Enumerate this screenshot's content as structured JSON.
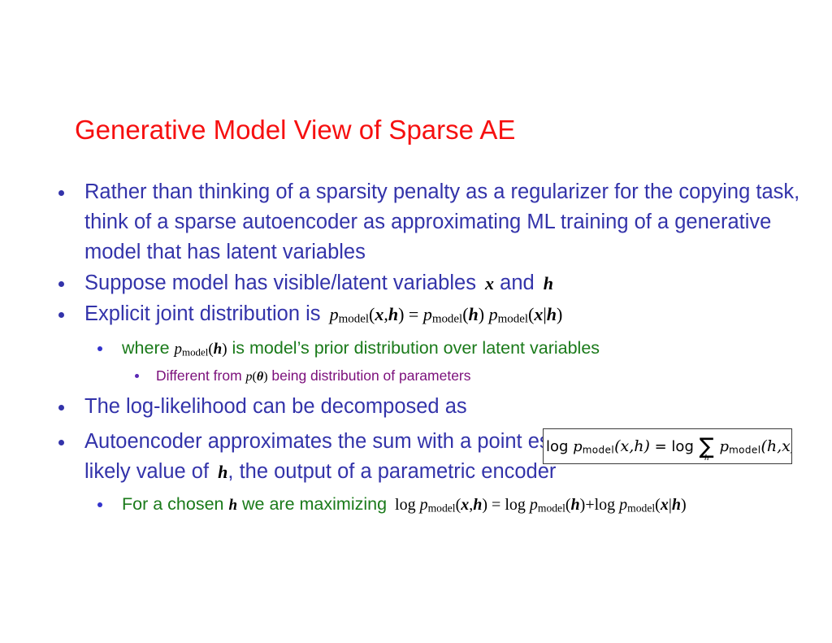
{
  "slide": {
    "title": "Generative Model View of Sparse AE",
    "colors": {
      "title": "#f61010",
      "body": "#3333aa",
      "sub": "#1a7a1a",
      "subsub": "#7b0f7b",
      "math": "#000000",
      "background": "#ffffff"
    },
    "bullets": [
      {
        "level": 1,
        "text": "Rather than thinking of a sparsity penalty as a regularizer for the copying task, think of a sparse autoencoder as approximating  ML training of a generative model that has latent variables"
      },
      {
        "level": 1,
        "text_before": "Suppose model has visible/latent variables ",
        "math_inline": "x and h",
        "var_1": "x",
        "between": " and ",
        "var_2": "h"
      },
      {
        "level": 1,
        "text_before": "Explicit joint distribution is ",
        "equation": "p_model(x,h) = p_model(h) p_model(x|h)"
      },
      {
        "level": 2,
        "text_before": "where ",
        "equation": "p_model(h)",
        "text_after": " is model’s prior distribution over latent variables"
      },
      {
        "level": 3,
        "text_before": "Different from ",
        "equation": "p(θ)",
        "text_after": " being distribution of parameters"
      },
      {
        "level": 1,
        "text": "The log-likelihood can be decomposed as"
      },
      {
        "level": 1,
        "text": "Autoencoder approximates the sum with a point estimate for just one highly likely value of h, the output of a parametric encoder",
        "text_part_1": "Autoencoder approximates the sum with a point estimate for just one highly likely value of ",
        "var_1": "h",
        "text_part_2": ", the output of a parametric encoder"
      },
      {
        "level": 2,
        "text_before": "For a chosen ",
        "var_1": "h",
        "text_mid": " we are maximizing ",
        "equation": "log p_model(x,h) = log p_model(h)+log p_model(x|h)"
      }
    ],
    "boxed_equation": {
      "text": "log p_model(x,h) = log ∑_h p_model(h,x)",
      "sum_subscript": "h",
      "border_color": "#3a3a3a"
    },
    "labels": {
      "p": "p",
      "model": "model",
      "log": "log",
      "sigma": "∑",
      "theta": "θ",
      "equals": "=",
      "plus": "+",
      "bar": "|",
      "comma": ",",
      "lparen": "(",
      "rparen": ")"
    }
  }
}
